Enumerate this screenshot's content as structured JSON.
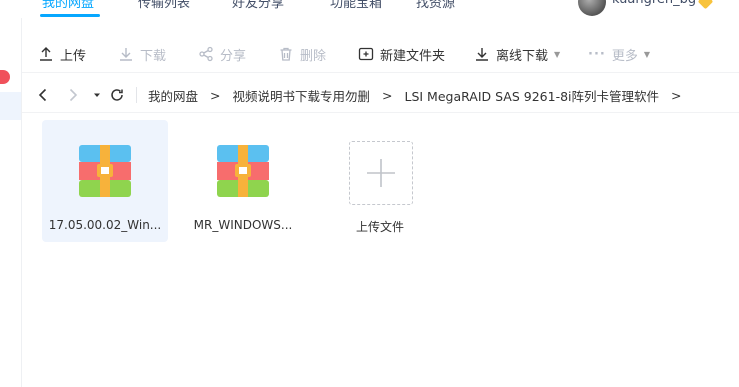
{
  "topnav": {
    "tabs": [
      "我的网盘",
      "传输列表",
      "好友分享",
      "功能宝箱",
      "找资源"
    ],
    "username": "kuangren_bg"
  },
  "sidebar": {
    "badge": ""
  },
  "toolbar": {
    "upload": "上传",
    "download": "下载",
    "share": "分享",
    "delete": "删除",
    "new_folder": "新建文件夹",
    "offline_download": "离线下载",
    "more": "更多"
  },
  "breadcrumb": {
    "items": [
      "我的网盘",
      "视频说明书下载专用勿删",
      "LSI MegaRAID SAS 9261-8i阵列卡管理软件"
    ],
    "separator": ">"
  },
  "files": [
    {
      "name": "17.05.00.02_Win...",
      "type": "archive",
      "selected": true
    },
    {
      "name": "MR_WINDOWS...",
      "type": "archive",
      "selected": false
    }
  ],
  "upload_tile": {
    "label": "上传文件"
  },
  "colors": {
    "accent": "#06a7ff",
    "selected_bg": "#eef4fd"
  }
}
